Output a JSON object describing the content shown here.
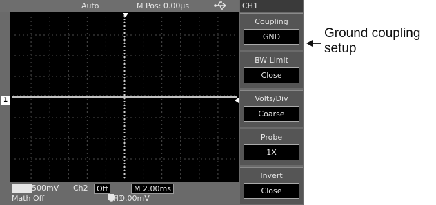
{
  "scope": {
    "top_bar": {
      "mode": "Auto",
      "position": "M Pos: 0.00µs",
      "usb_icon": "usb-icon"
    },
    "status": {
      "ch1_badge": "CH1",
      "ch1_scale": "500mV",
      "ch2_label": "Ch2",
      "ch2_value": "Off",
      "timebase": "M 2.00ms",
      "math": "Math Off",
      "trigger_badge": "T",
      "trigger_source": "CH1",
      "trigger_slope_icon": "rising-edge-icon",
      "trigger_level": "0.00mV"
    },
    "channel_marker": "1",
    "colors": {
      "screen": "#000000",
      "panel": "#6a6a6a",
      "trace": "#ffffff"
    }
  },
  "menu": {
    "title": "CH1",
    "items": [
      {
        "label": "Coupling",
        "value": "GND"
      },
      {
        "label": "BW Limit",
        "value": "Close"
      },
      {
        "label": "Volts/Div",
        "value": "Coarse"
      },
      {
        "label": "Probe",
        "value": "1X"
      },
      {
        "label": "Invert",
        "value": "Close"
      }
    ]
  },
  "annotation": {
    "text": "Ground coupling setup"
  }
}
